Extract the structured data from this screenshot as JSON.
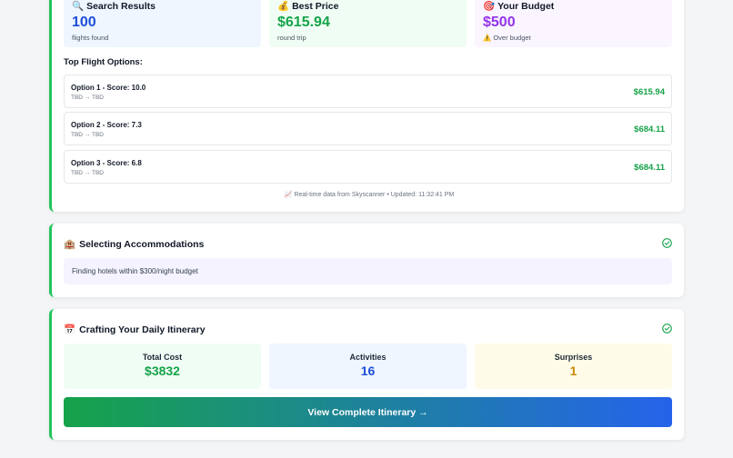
{
  "stats": {
    "search": {
      "icon": "🔍",
      "title": "Search Results",
      "value": "100",
      "sub": "flights found",
      "color": "#1d4ed8",
      "bg": "#eff6ff"
    },
    "price": {
      "icon": "💰",
      "title": "Best Price",
      "value": "$615.94",
      "sub": "round trip",
      "color": "#16a34a",
      "bg": "#f0fdf4"
    },
    "budget": {
      "icon": "🎯",
      "title": "Your Budget",
      "value": "$500",
      "sub_icon": "⚠️",
      "sub": "Over budget",
      "color": "#9333ea",
      "bg": "#faf5ff"
    }
  },
  "options_title": "Top Flight Options:",
  "options": [
    {
      "name": "Option 1 - Score: 10.0",
      "route": "TBD → TBD",
      "price": "$615.94"
    },
    {
      "name": "Option 2 - Score: 7.3",
      "route": "TBD → TBD",
      "price": "$684.11"
    },
    {
      "name": "Option 3 - Score: 6.8",
      "route": "TBD → TBD",
      "price": "$684.11"
    }
  ],
  "footnote": {
    "icon": "📈",
    "text": "Real-time data from Skyscanner • Updated: 11:32:41 PM"
  },
  "accommodations": {
    "icon": "🏨",
    "title": "Selecting Accommodations",
    "text": "Finding hotels within $300/night budget"
  },
  "itinerary": {
    "icon": "📅",
    "title": "Crafting Your Daily Itinerary",
    "tiles": [
      {
        "label": "Total Cost",
        "value": "$3832",
        "color": "#16a34a",
        "bg": "#f0fdf4"
      },
      {
        "label": "Activities",
        "value": "16",
        "color": "#1d4ed8",
        "bg": "#eff6ff"
      },
      {
        "label": "Surprises",
        "value": "1",
        "color": "#ca8a04",
        "bg": "#fefce8"
      }
    ],
    "cta": "View Complete Itinerary →"
  },
  "colors": {
    "accent": "#22c55e",
    "check": "#16a34a"
  }
}
